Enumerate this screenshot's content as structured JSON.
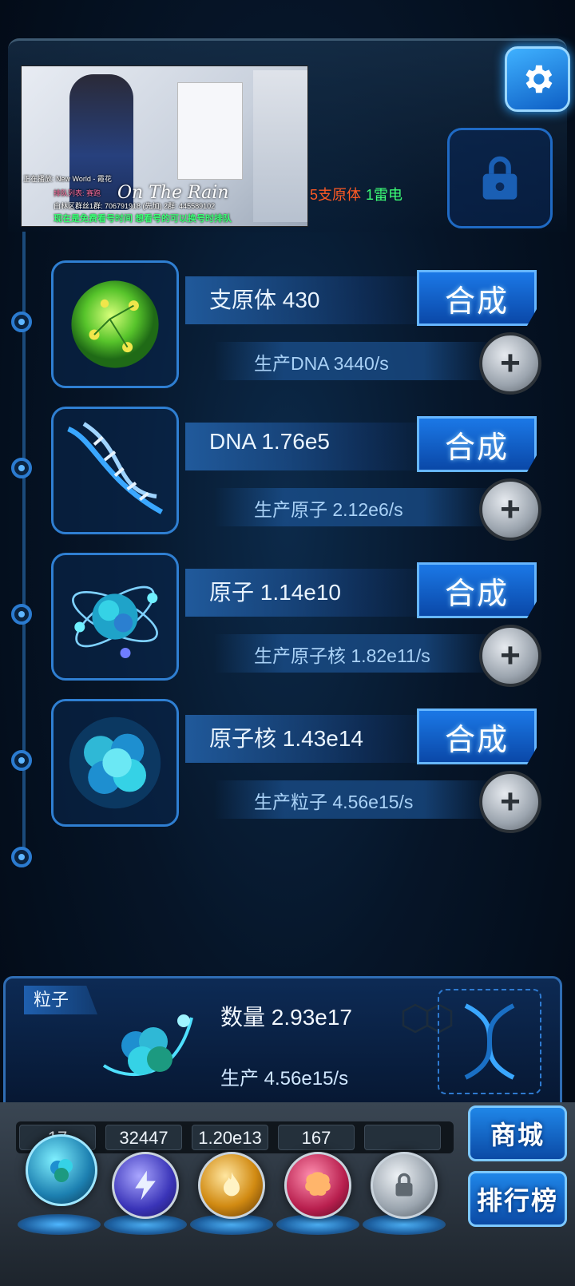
{
  "stream_overlay": {
    "now_playing": "正在播放: New World - 霞花",
    "queue_label": "排队列表: 赛跑",
    "title": "On The Rain",
    "group_info": "白林区群丝1群: 706791918 (先加)  2群: 445589102",
    "notice": "现在是免费看号时间 想看号的可以换号时排队"
  },
  "top_status": {
    "part1": "5支原体",
    "part2": "1雷电"
  },
  "rows": [
    {
      "title": "支原体 430",
      "production": "生产DNA 3440/s",
      "craft_label": "合成",
      "plus_label": "+"
    },
    {
      "title": "DNA 1.76e5",
      "production": "生产原子 2.12e6/s",
      "craft_label": "合成",
      "plus_label": "+"
    },
    {
      "title": "原子 1.14e10",
      "production": "生产原子核 1.82e11/s",
      "craft_label": "合成",
      "plus_label": "+"
    },
    {
      "title": "原子核 1.43e14",
      "production": "生产粒子 4.56e15/s",
      "craft_label": "合成",
      "plus_label": "+"
    }
  ],
  "particle_panel": {
    "tag": "粒子",
    "count": "数量 2.93e17",
    "production": "生产 4.56e15/s"
  },
  "dock": {
    "counters": [
      "17",
      "32447",
      "1.20e13",
      "167",
      ""
    ],
    "orbs": [
      "particle-orb",
      "lightning-orb",
      "fire-orb",
      "brain-orb",
      "locked-orb"
    ]
  },
  "side_buttons": {
    "shop": "商城",
    "leaderboard": "排行榜"
  },
  "colors": {
    "accent": "#1b78e6",
    "highlight_red": "#ff5a24",
    "highlight_green": "#3cff76"
  }
}
